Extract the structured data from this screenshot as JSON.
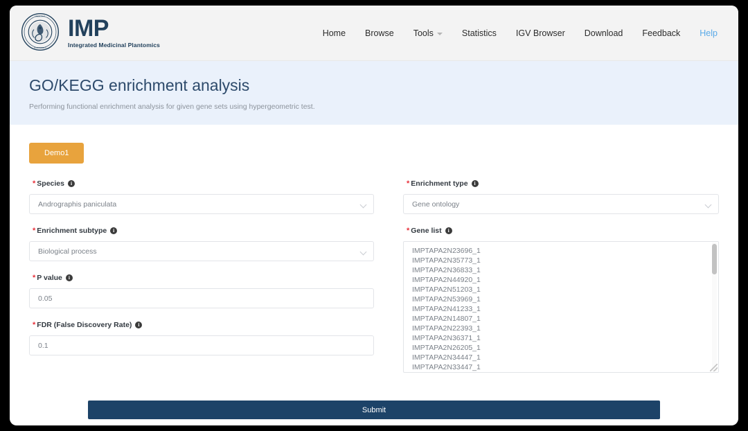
{
  "brand": {
    "title": "IMP",
    "subtitle": "Integrated Medicinal Plantomics",
    "seal_icon": "circular-seal-logo"
  },
  "nav": {
    "items": [
      {
        "label": "Home",
        "has_caret": false,
        "highlight": false
      },
      {
        "label": "Browse",
        "has_caret": false,
        "highlight": false
      },
      {
        "label": "Tools",
        "has_caret": true,
        "highlight": false
      },
      {
        "label": "Statistics",
        "has_caret": false,
        "highlight": false
      },
      {
        "label": "IGV Browser",
        "has_caret": false,
        "highlight": false
      },
      {
        "label": "Download",
        "has_caret": false,
        "highlight": false
      },
      {
        "label": "Feedback",
        "has_caret": false,
        "highlight": false
      },
      {
        "label": "Help",
        "has_caret": false,
        "highlight": true
      }
    ]
  },
  "banner": {
    "title": "GO/KEGG enrichment analysis",
    "subtitle": "Performing functional enrichment analysis for given gene sets using hypergeometric test."
  },
  "form": {
    "demo_button": "Demo1",
    "submit_button": "Submit",
    "required_marker": "*",
    "info_glyph": "i",
    "species": {
      "label": "Species",
      "value": "Andrographis paniculata"
    },
    "enrichment_type": {
      "label": "Enrichment type",
      "value": "Gene ontology"
    },
    "enrichment_subtype": {
      "label": "Enrichment subtype",
      "value": "Biological process"
    },
    "p_value": {
      "label": "P value",
      "value": "0.05"
    },
    "fdr": {
      "label": "FDR (False Discovery Rate)",
      "value": "0.1"
    },
    "gene_list": {
      "label": "Gene list",
      "genes": [
        "IMPTAPA2N23696_1",
        "IMPTAPA2N35773_1",
        "IMPTAPA2N36833_1",
        "IMPTAPA2N44920_1",
        "IMPTAPA2N51203_1",
        "IMPTAPA2N53969_1",
        "IMPTAPA2N41233_1",
        "IMPTAPA2N14807_1",
        "IMPTAPA2N22393_1",
        "IMPTAPA2N36371_1",
        "IMPTAPA2N26205_1",
        "IMPTAPA2N34447_1",
        "IMPTAPA2N33447_1"
      ]
    }
  },
  "colors": {
    "brand_navy": "#22415c",
    "banner_bg": "#eaf1fb",
    "demo_orange": "#e8a33d",
    "submit_navy": "#1d4368",
    "required_red": "#e8303a",
    "help_blue": "#5aaae8"
  }
}
